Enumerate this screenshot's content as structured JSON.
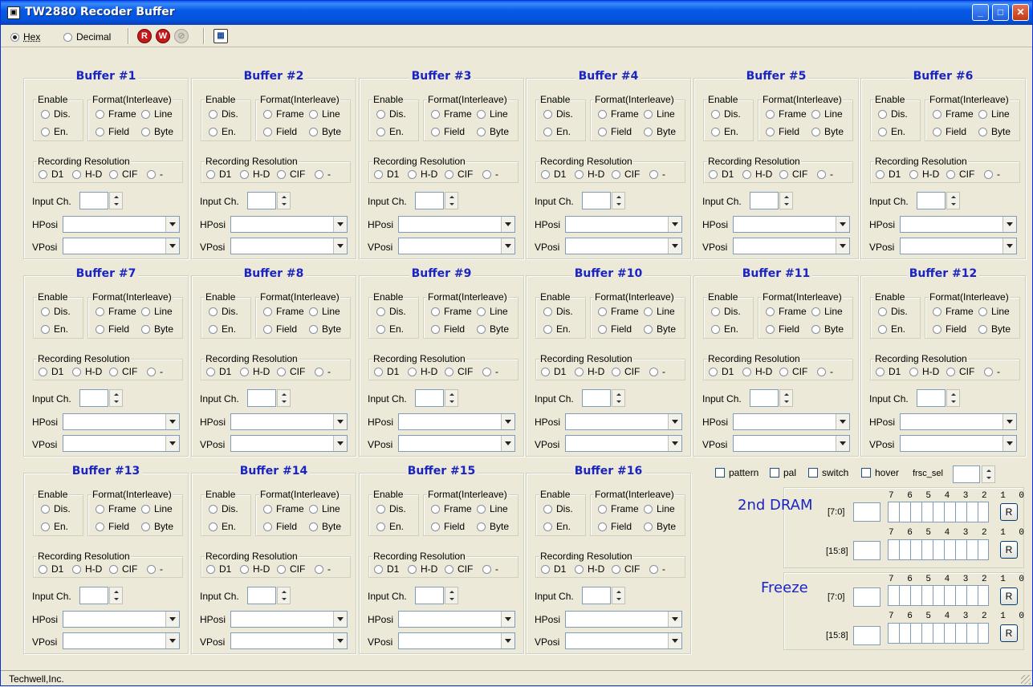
{
  "window": {
    "title": "TW2880 Recoder Buffer",
    "controls": {
      "minimize": "_",
      "maximize": "□",
      "close": "✕"
    }
  },
  "toolbar": {
    "hex_label": "Hex",
    "decimal_label": "Decimal",
    "selected_format": "Hex",
    "icons": [
      "read-icon",
      "write-icon",
      "refresh-disabled-icon",
      "calendar-icon"
    ]
  },
  "buffer_labels": {
    "enable": "Enable",
    "dis": "Dis.",
    "en": "En.",
    "format": "Format(Interleave)",
    "frame": "Frame",
    "line": "Line",
    "field": "Field",
    "byte": "Byte",
    "recording_resolution": "Recording Resolution",
    "d1": "D1",
    "hd": "H-D",
    "cif": "CIF",
    "dash": "-",
    "input_ch": "Input Ch.",
    "hposi": "HPosi",
    "vposi": "VPosi"
  },
  "buffers": [
    {
      "title": "Buffer #1"
    },
    {
      "title": "Buffer #2"
    },
    {
      "title": "Buffer #3"
    },
    {
      "title": "Buffer #4"
    },
    {
      "title": "Buffer #5"
    },
    {
      "title": "Buffer #6"
    },
    {
      "title": "Buffer #7"
    },
    {
      "title": "Buffer #8"
    },
    {
      "title": "Buffer #9"
    },
    {
      "title": "Buffer #10"
    },
    {
      "title": "Buffer #11"
    },
    {
      "title": "Buffer #12"
    },
    {
      "title": "Buffer #13"
    },
    {
      "title": "Buffer #14"
    },
    {
      "title": "Buffer #15"
    },
    {
      "title": "Buffer #16"
    }
  ],
  "options": {
    "pattern": "pattern",
    "pal": "pal",
    "switch": "switch",
    "hover": "hover",
    "frsc_sel": "frsc_sel"
  },
  "registers": {
    "bit_labels": "7 6 5 4 3 2 1 0",
    "second_dram": {
      "title": "2nd DRAM",
      "low": "[7:0]",
      "high": "[15:8]"
    },
    "freeze": {
      "title": "Freeze",
      "low": "[7:0]",
      "high": "[15:8]"
    },
    "refresh_label": "R"
  },
  "status": {
    "text": "Techwell,Inc."
  }
}
